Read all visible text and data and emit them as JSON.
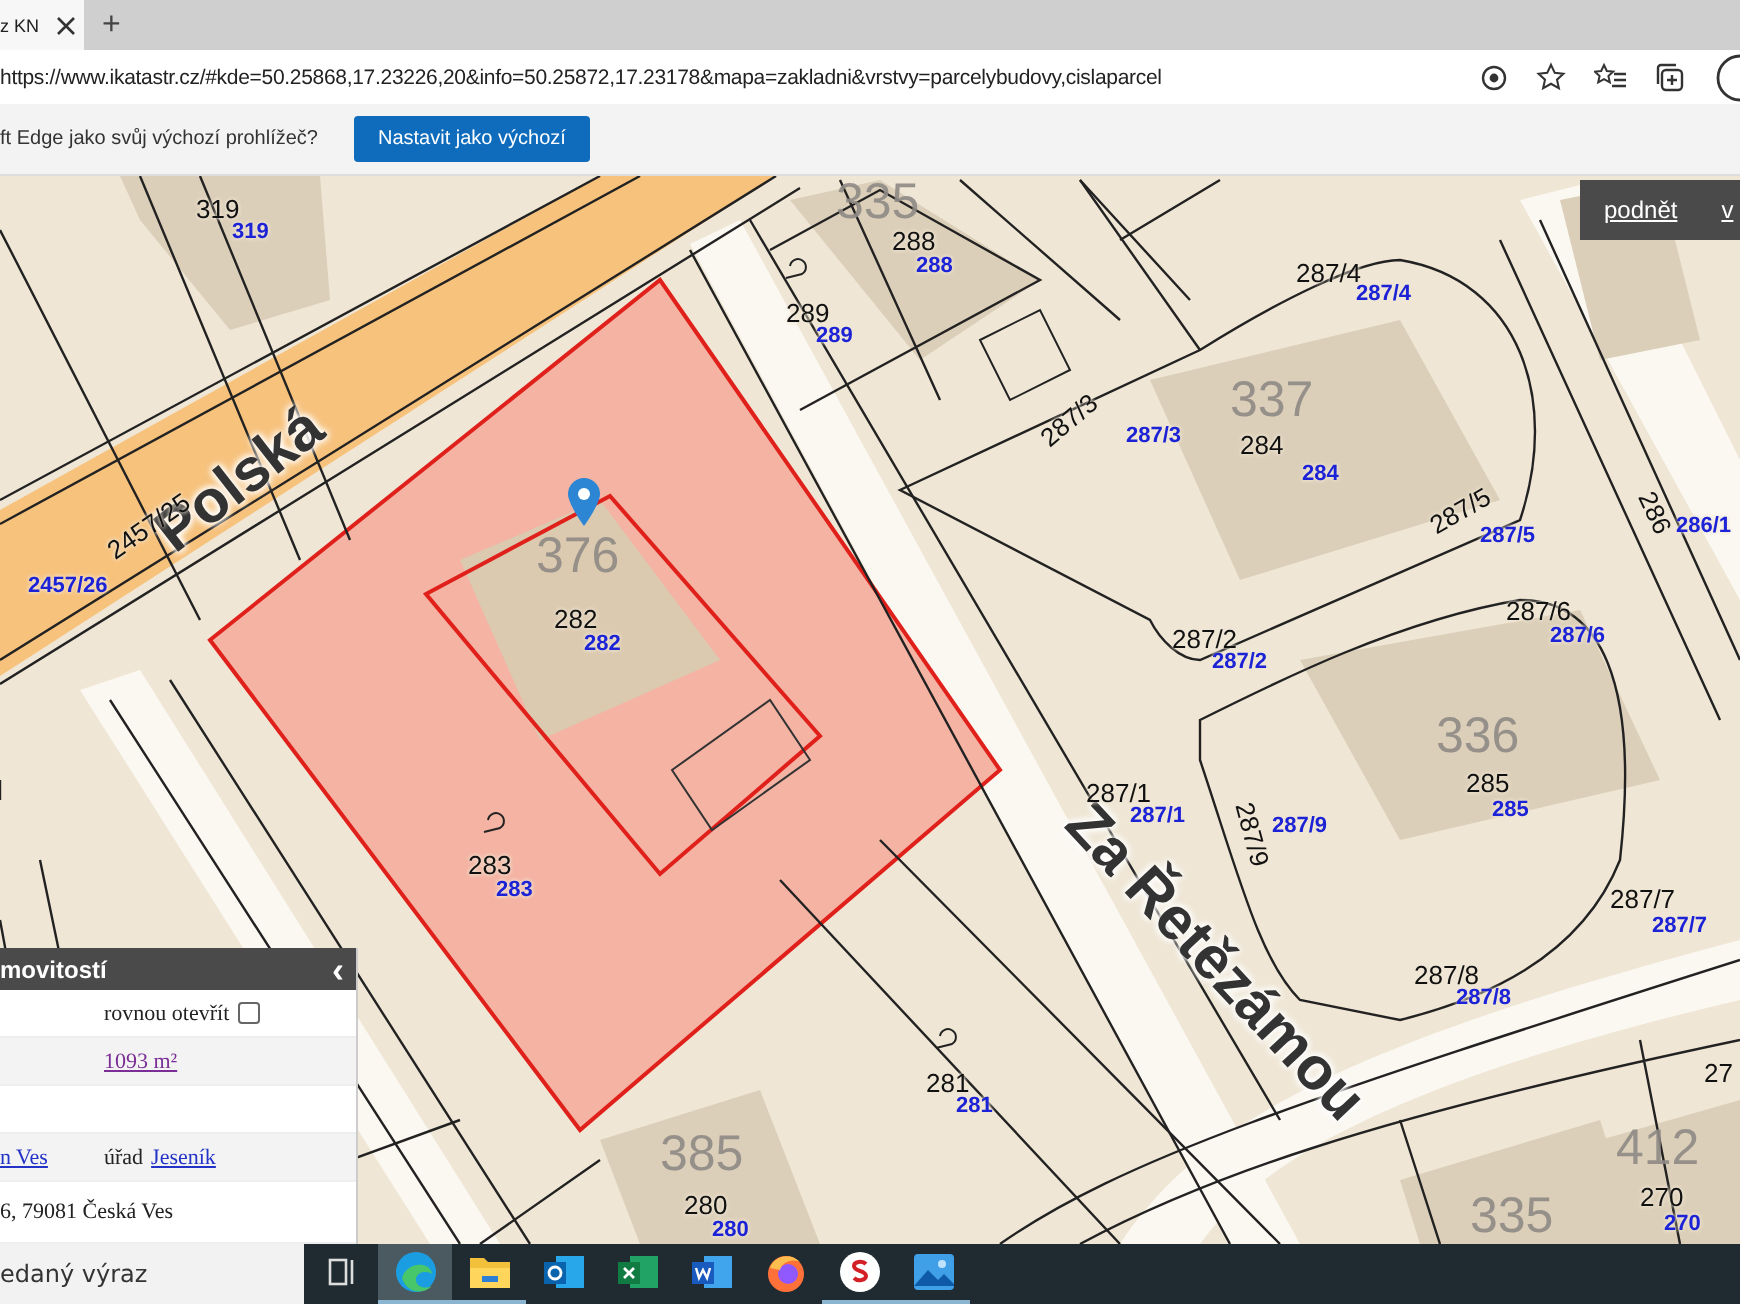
{
  "browser": {
    "tab_title": "z KN",
    "new_tab": "+",
    "address": "https://www.ikatastr.cz/#kde=50.25868,17.23226,20&info=50.25872,17.23178&mapa=zakladni&vrstvy=parcelybudovy,cislaparcel",
    "banner_text": "ft Edge jako svůj výchozí prohlížeč?",
    "banner_button": "Nastavit jako výchozí"
  },
  "map": {
    "streets": [
      "Polská",
      "Za Řetězámou"
    ],
    "buildings": [
      "335",
      "376",
      "337",
      "336",
      "385",
      "412",
      "335"
    ],
    "parcels": [
      {
        "number": "319",
        "link": "319"
      },
      {
        "number": "288",
        "link": "288"
      },
      {
        "number": "289",
        "link": "289"
      },
      {
        "number": "287/4",
        "link": "287/4"
      },
      {
        "number": "287/3",
        "link": "287/3"
      },
      {
        "number": "284",
        "link": "284"
      },
      {
        "number": "287/5",
        "link": "287/5"
      },
      {
        "number": "286",
        "link": "286/1"
      },
      {
        "number": "2457/25",
        "link": "2457/26"
      },
      {
        "number": "282",
        "link": "282"
      },
      {
        "number": "287/2",
        "link": "287/2"
      },
      {
        "number": "287/6",
        "link": "287/6"
      },
      {
        "number": "287/1",
        "link": "287/1"
      },
      {
        "number": "287/9",
        "link": "287/9"
      },
      {
        "number": "285",
        "link": "285"
      },
      {
        "number": "283",
        "link": "283"
      },
      {
        "number": "287/7",
        "link": "287/7"
      },
      {
        "number": "287/8",
        "link": "287/8"
      },
      {
        "number": "281",
        "link": "281"
      },
      {
        "number": "27"
      },
      {
        "number": "280",
        "link": "280"
      },
      {
        "number": "270",
        "link": "270"
      }
    ],
    "top_links": [
      "podnět",
      "v"
    ]
  },
  "panel": {
    "title": "movitostí",
    "collapse": "‹",
    "open_directly": {
      "label": "rovnou otevřít",
      "checked": false
    },
    "area": "1093 m²",
    "municipality_link": "n Ves",
    "office_label": "úřad",
    "office_link": "Jeseník",
    "address": "6, 79081 Česká Ves"
  },
  "taskbar": {
    "search_placeholder": "edaný výraz",
    "apps": [
      {
        "kind": "taskview",
        "active": false,
        "running": false
      },
      {
        "kind": "edge",
        "active": true,
        "running": true
      },
      {
        "kind": "explorer",
        "active": false,
        "running": true
      },
      {
        "kind": "outlook",
        "active": false,
        "running": false
      },
      {
        "kind": "excel",
        "active": false,
        "running": false
      },
      {
        "kind": "word",
        "active": false,
        "running": false
      },
      {
        "kind": "firefox",
        "active": false,
        "running": false
      },
      {
        "kind": "sapp",
        "active": false,
        "running": true
      },
      {
        "kind": "photos",
        "active": false,
        "running": true
      }
    ]
  }
}
